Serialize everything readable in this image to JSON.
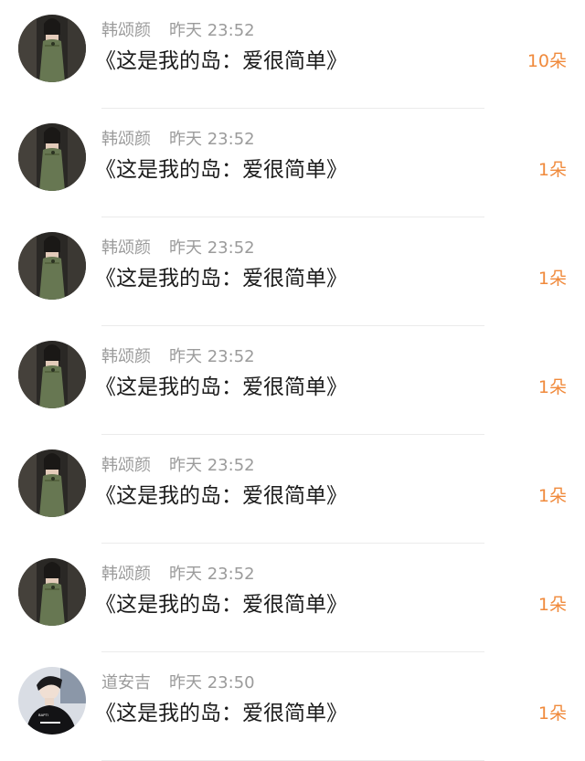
{
  "items": [
    {
      "name": "韩颂颜",
      "date": "昨天",
      "time": "23:52",
      "message": "《这是我的岛：爱很简单》",
      "count": "10朵"
    },
    {
      "name": "韩颂颜",
      "date": "昨天",
      "time": "23:52",
      "message": "《这是我的岛：爱很简单》",
      "count": "1朵"
    },
    {
      "name": "韩颂颜",
      "date": "昨天",
      "time": "23:52",
      "message": "《这是我的岛：爱很简单》",
      "count": "1朵"
    },
    {
      "name": "韩颂颜",
      "date": "昨天",
      "time": "23:52",
      "message": "《这是我的岛：爱很简单》",
      "count": "1朵"
    },
    {
      "name": "韩颂颜",
      "date": "昨天",
      "time": "23:52",
      "message": "《这是我的岛：爱很简单》",
      "count": "1朵"
    },
    {
      "name": "韩颂颜",
      "date": "昨天",
      "time": "23:52",
      "message": "《这是我的岛：爱很简单》",
      "count": "1朵"
    },
    {
      "name": "道安吉",
      "date": "昨天",
      "time": "23:50",
      "message": "《这是我的岛：爱很简单》",
      "count": "1朵"
    }
  ],
  "colors": {
    "meta_text": "#9b9b9b",
    "message_text": "#1c1c1c",
    "count_accent": "#f08a3c",
    "divider": "#ebebeb"
  }
}
